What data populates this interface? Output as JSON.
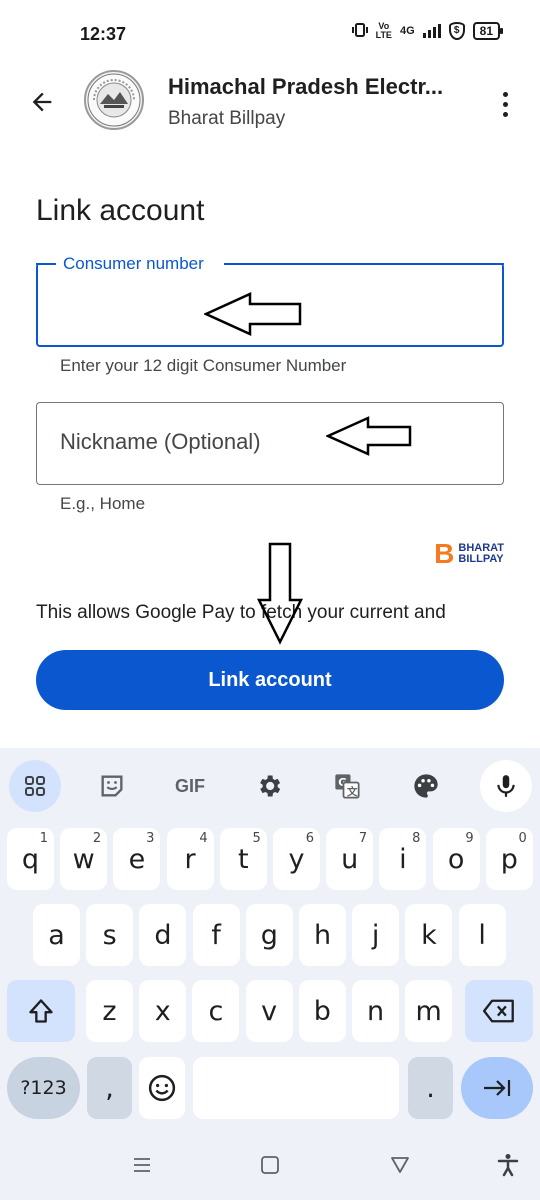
{
  "status_bar": {
    "time": "12:37",
    "volte": "Vo\nLTE",
    "network": "4G",
    "battery": "81"
  },
  "app_bar": {
    "title": "Himachal Pradesh Electr...",
    "subtitle": "Bharat Billpay"
  },
  "form": {
    "heading": "Link account",
    "consumer_label": "Consumer number",
    "consumer_value": "",
    "consumer_helper": "Enter your 12 digit Consumer Number",
    "nickname_placeholder": "Nickname (Optional)",
    "nickname_helper": "E.g., Home"
  },
  "bbps": {
    "mark": "B",
    "line1": "BHARAT",
    "line2": "BILLPAY"
  },
  "disclaimer": "This allows Google Pay to fetch your current and",
  "cta_label": "Link account",
  "keyboard": {
    "toolbar": {
      "gif_label": "GIF"
    },
    "row1": [
      {
        "k": "q",
        "n": "1"
      },
      {
        "k": "w",
        "n": "2"
      },
      {
        "k": "e",
        "n": "3"
      },
      {
        "k": "r",
        "n": "4"
      },
      {
        "k": "t",
        "n": "5"
      },
      {
        "k": "y",
        "n": "6"
      },
      {
        "k": "u",
        "n": "7"
      },
      {
        "k": "i",
        "n": "8"
      },
      {
        "k": "o",
        "n": "9"
      },
      {
        "k": "p",
        "n": "0"
      }
    ],
    "row2": [
      "a",
      "s",
      "d",
      "f",
      "g",
      "h",
      "j",
      "k",
      "l"
    ],
    "row3": [
      "z",
      "x",
      "c",
      "v",
      "b",
      "n",
      "m"
    ],
    "sym_label": "?123",
    "comma_label": ",",
    "period_label": "."
  },
  "colors": {
    "accent": "#0b57d0",
    "keyboard_bg": "#eef1f8",
    "bbps_orange": "#f47b20",
    "bbps_blue": "#1e3a8a"
  }
}
